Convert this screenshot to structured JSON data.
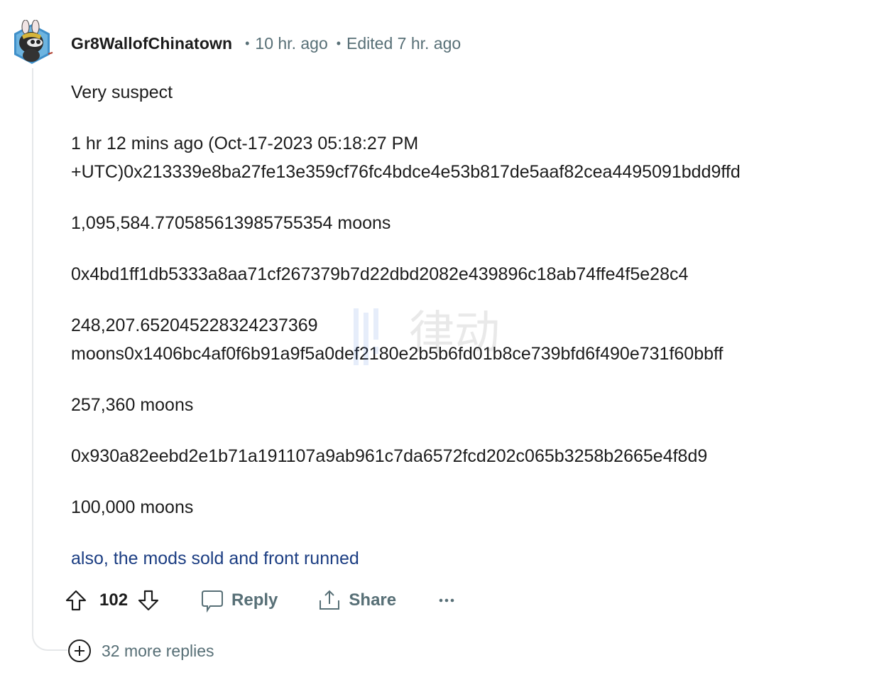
{
  "comment": {
    "username": "Gr8WallofChinatown",
    "posted_time": "10 hr. ago",
    "edited_time": "Edited 7 hr. ago",
    "avatar": "avatar-icon",
    "paragraphs": [
      "Very suspect",
      "1 hr 12 mins ago (Oct-17-2023 05:18:27 PM",
      "+UTC)0x213339e8ba27fe13e359cf76fc4bdce4e53b817de5aaf82cea4495091bdd9ffd",
      "1,095,584.770585613985755354 moons",
      "0x4bd1ff1db5333a8aa71cf267379b7d22dbd2082e439896c18ab74ffe4f5e28c4",
      "248,207.652045228324237369",
      "moons0x1406bc4af0f6b91a9f5a0def2180e2b5b6fd01b8ce739bfd6f490e731f60bbff",
      "257,360 moons",
      "0x930a82eebd2e1b71a191107a9ab961c7da6572fcd202c065b3258b2665e4f8d9",
      "100,000 moons"
    ],
    "link_text": "also, the mods sold and front runned"
  },
  "actions": {
    "score": "102",
    "reply_label": "Reply",
    "share_label": "Share",
    "icons": {
      "upvote": "upvote-arrow-icon",
      "downvote": "downvote-arrow-icon",
      "reply": "speech-bubble-icon",
      "share": "share-upload-icon",
      "more": "ellipsis-icon"
    }
  },
  "thread": {
    "more_replies_label": "32 more replies",
    "expand_icon": "plus-circle-icon"
  },
  "colors": {
    "text_primary": "#1c1c1c",
    "text_meta": "#576f76",
    "link": "#1b3d82",
    "thread_line": "#e5e7e9"
  }
}
